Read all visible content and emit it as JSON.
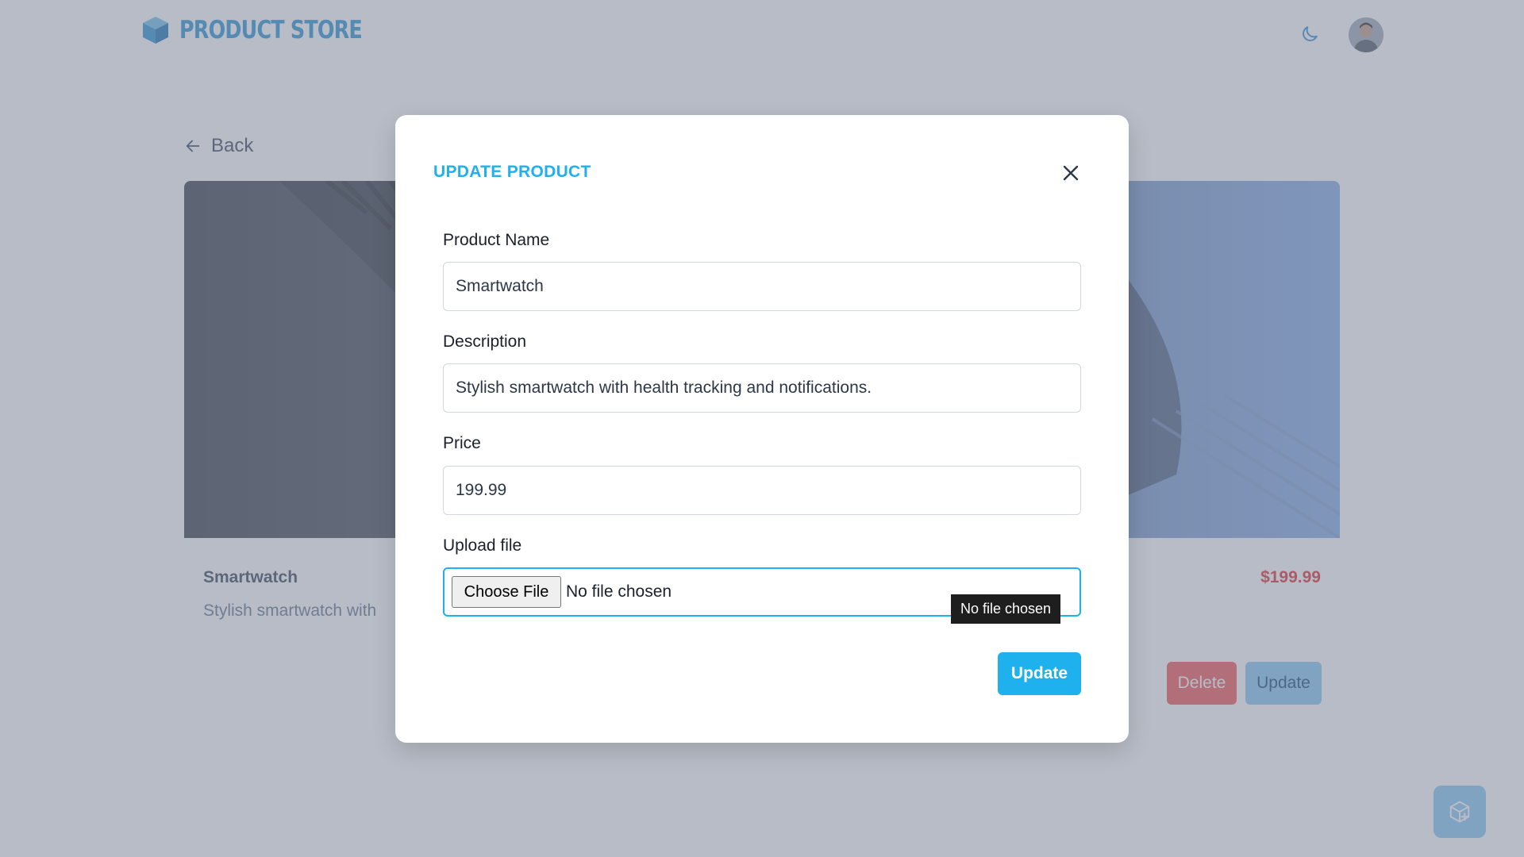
{
  "navbar": {
    "brand": "PRODUCT STORE",
    "brand_icon": "cube-icon",
    "theme_icon": "moon-icon",
    "avatar_icon": "user-avatar"
  },
  "back": {
    "label": "Back",
    "icon": "arrow-left-icon"
  },
  "product": {
    "name": "Smartwatch",
    "description": "Stylish smartwatch with",
    "price": "$199.99",
    "delete_label": "Delete",
    "update_label": "Update"
  },
  "fab": {
    "icon": "add-box-icon"
  },
  "modal": {
    "title": "UPDATE PRODUCT",
    "close_icon": "close-icon",
    "fields": {
      "name": {
        "label": "Product Name",
        "value": "Smartwatch"
      },
      "description": {
        "label": "Description",
        "value": "Stylish smartwatch with health tracking and notifications."
      },
      "price": {
        "label": "Price",
        "value": "199.99"
      },
      "file": {
        "label": "Upload file",
        "button": "Choose File",
        "status": "No file chosen",
        "tooltip": "No file chosen"
      }
    },
    "submit_label": "Update"
  },
  "colors": {
    "accent": "#1fb1ee",
    "brand": "#3b9ad6",
    "danger": "#f56565",
    "price": "#e53e3e",
    "overlay": "rgba(112,122,142,0.5)"
  }
}
